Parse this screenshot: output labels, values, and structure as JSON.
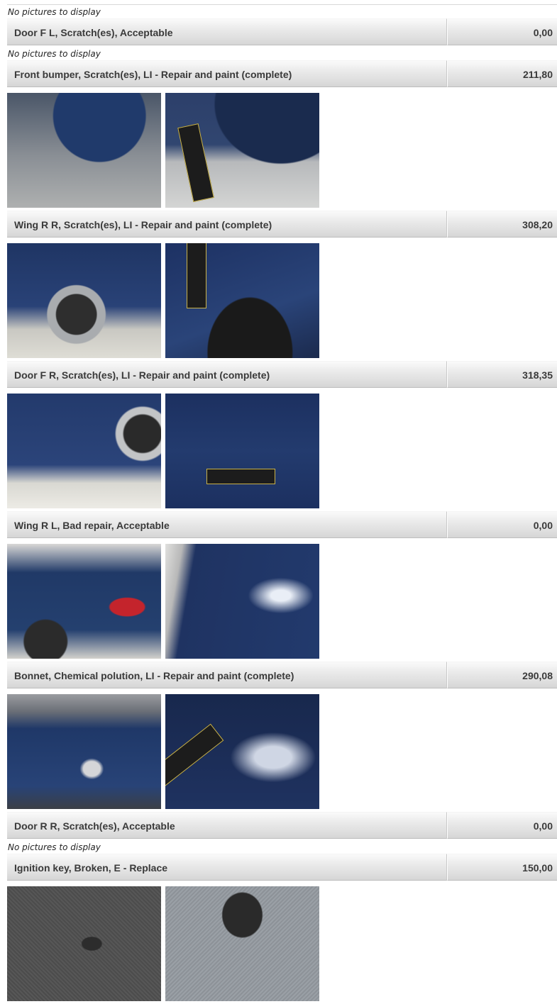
{
  "no_pictures_label": "No pictures to display",
  "items": [
    {
      "description": "Door F L, Scratch(es), Acceptable",
      "amount": "0,00",
      "pictures": []
    },
    {
      "description": "Front bumper, Scratch(es), LI - Repair and paint (complete)",
      "amount": "211,80",
      "pictures": [
        "front-bumper-photo-1",
        "front-bumper-photo-2"
      ]
    },
    {
      "description": "Wing R R, Scratch(es), LI - Repair and paint (complete)",
      "amount": "308,20",
      "pictures": [
        "wing-rr-photo-1",
        "wing-rr-photo-2"
      ]
    },
    {
      "description": "Door F R, Scratch(es), LI - Repair and paint (complete)",
      "amount": "318,35",
      "pictures": [
        "door-fr-photo-1",
        "door-fr-photo-2"
      ]
    },
    {
      "description": "Wing R L, Bad repair, Acceptable",
      "amount": "0,00",
      "pictures": [
        "wing-rl-photo-1",
        "wing-rl-photo-2"
      ]
    },
    {
      "description": "Bonnet, Chemical polution, LI - Repair and paint (complete)",
      "amount": "290,08",
      "pictures": [
        "bonnet-photo-1",
        "bonnet-photo-2"
      ]
    },
    {
      "description": "Door R R, Scratch(es), Acceptable",
      "amount": "0,00",
      "pictures": []
    },
    {
      "description": "Ignition key, Broken, E - Replace",
      "amount": "150,00",
      "pictures": [
        "ignition-key-photo-1",
        "ignition-key-photo-2"
      ]
    }
  ]
}
